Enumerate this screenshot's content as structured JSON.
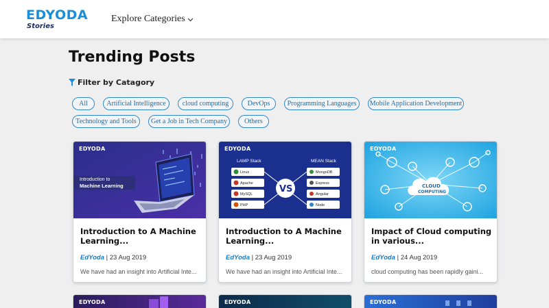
{
  "header": {
    "logo_main": "EDYODA",
    "logo_sub": "Stories",
    "explore_label": "Explore Categories"
  },
  "page": {
    "title": "Trending Posts",
    "filter_label": "Filter by Catagory"
  },
  "categories": [
    "All",
    "Artificial Intelligence",
    "cloud computing",
    "DevOps",
    "Programming Languages",
    "Mobile Application Development",
    "Technology and Tools",
    "Get a Job in Tech Company",
    "Others"
  ],
  "cards": [
    {
      "brand": "EDYODA",
      "thumb_line1": "Introduction to",
      "thumb_line2": "Machine Learning",
      "title": "Introduction to A Machine Learning...",
      "author": "EdYoda",
      "date": "23 Aug 2019",
      "excerpt": "We have had an insight into Artificial Inte..."
    },
    {
      "brand": "EDYODA",
      "thumb_left_header": "LAMP Stack",
      "thumb_right_header": "MEAN Stack",
      "thumb_vs": "VS",
      "thumb_left_items": [
        "Linux",
        "Apache",
        "MySQL",
        "PHP"
      ],
      "thumb_right_items": [
        "MongoDB",
        "Express",
        "Angular",
        "Node"
      ],
      "title": "Introduction to A Machine Learning...",
      "author": "EdYoda",
      "date": "23 Aug 2019",
      "excerpt": "We have had an insight into Artificial Inte..."
    },
    {
      "brand": "EDYODA",
      "thumb_cloud_line1": "CLOUD",
      "thumb_cloud_line2": "COMPUTING",
      "title": "Impact of Cloud computing in various...",
      "author": "EdYoda",
      "date": "24 Aug 2019",
      "excerpt": "cloud computing has been rapidly gaini..."
    }
  ],
  "partial_cards": [
    {
      "brand": "EDYODA"
    },
    {
      "brand": "EDYODA"
    },
    {
      "brand": "EDYODA"
    }
  ],
  "colors": {
    "brand_blue": "#1a8ed8",
    "pill_border": "#2e86c8",
    "author_blue": "#1f79c4"
  },
  "meta_separator": "|"
}
